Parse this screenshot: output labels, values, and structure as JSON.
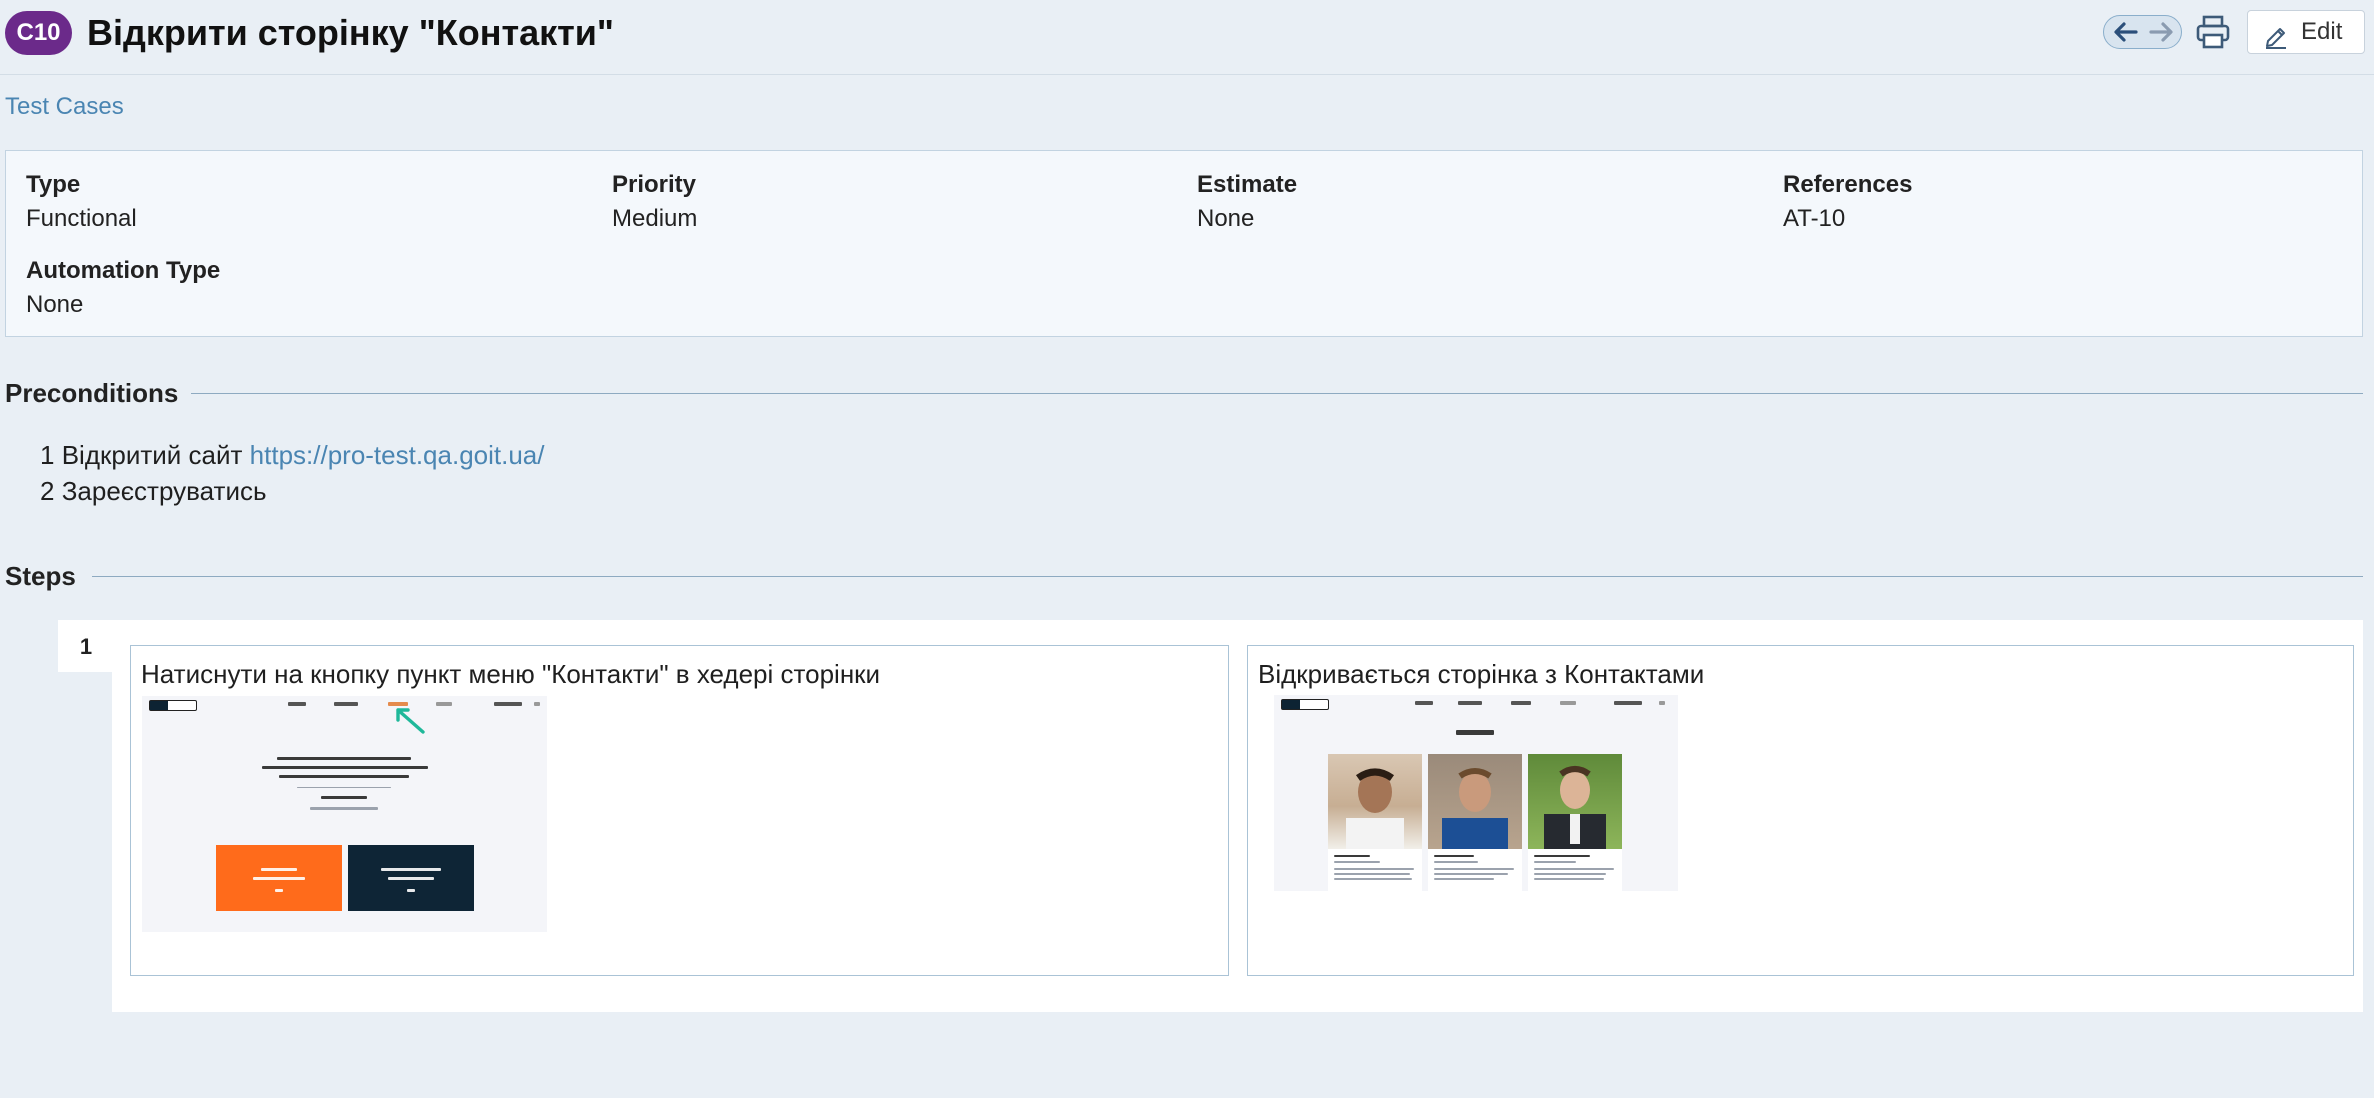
{
  "header": {
    "case_id": "C10",
    "title": "Відкрити сторінку \"Контакти\"",
    "prev_icon": "arrow-left-icon",
    "next_icon": "arrow-right-icon",
    "print_icon": "printer-icon",
    "edit_label": "Edit",
    "accent": "#6b2a8a"
  },
  "breadcrumb": {
    "label": "Test Cases",
    "color": "#4a85b2"
  },
  "fields": [
    {
      "label": "Type",
      "value": "Functional"
    },
    {
      "label": "Priority",
      "value": "Medium"
    },
    {
      "label": "Estimate",
      "value": "None"
    },
    {
      "label": "References",
      "value": "AT-10"
    },
    {
      "label": "Automation Type",
      "value": "None"
    }
  ],
  "preconditions": {
    "title": "Preconditions",
    "items": [
      {
        "num": "1",
        "text": "Відкритий сайт",
        "link": "https://pro-test.qa.goit.ua/"
      },
      {
        "num": "2",
        "text": "Зареєструватись"
      }
    ]
  },
  "steps": {
    "title": "Steps",
    "items": [
      {
        "number": "1",
        "step": "Натиснути на кнопку пункт меню \"Контакти\" в хедері сторінки",
        "expected": "Відкривається сторінка з Контактами"
      }
    ]
  }
}
